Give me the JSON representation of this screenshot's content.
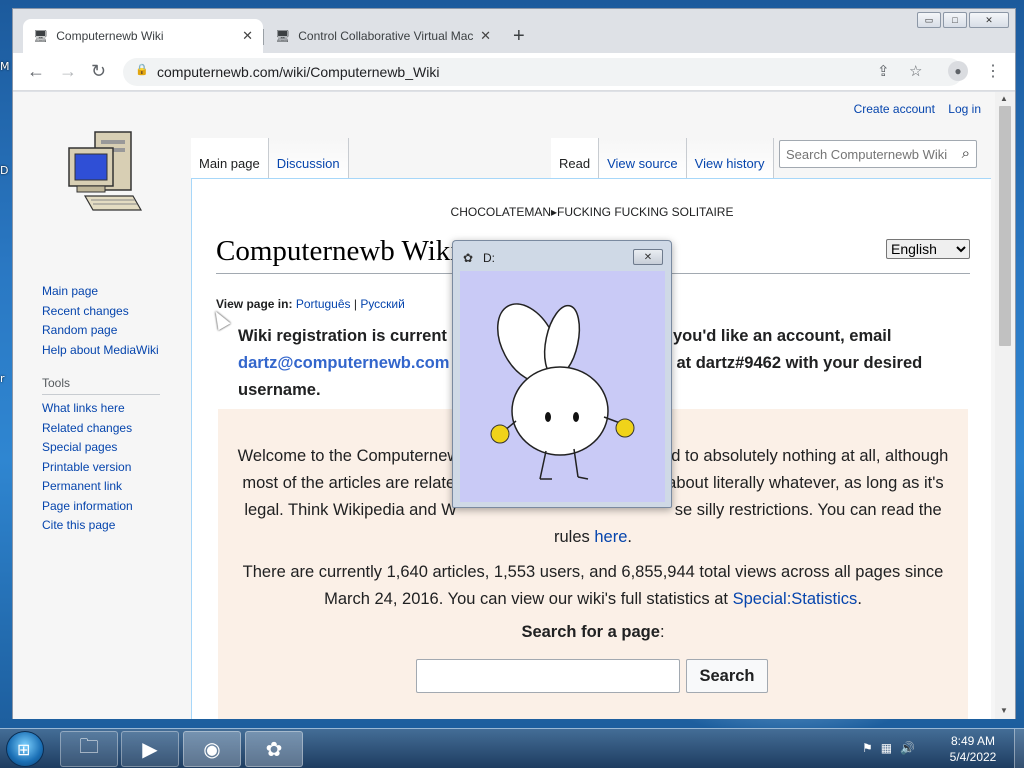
{
  "browser": {
    "tabs": [
      {
        "title": "Computernewb Wiki",
        "active": true
      },
      {
        "title": "Control Collaborative Virtual Mac",
        "active": false
      }
    ],
    "url": "computernewb.com/wiki/Computernewb_Wiki",
    "window_controls": {
      "minimize": "▭",
      "maximize": "□",
      "close": "✕"
    }
  },
  "wiki": {
    "personal": {
      "create_account": "Create account",
      "login": "Log in"
    },
    "namespaces": [
      "Main page",
      "Discussion"
    ],
    "views": [
      "Read",
      "View source",
      "View history"
    ],
    "search_placeholder": "Search Computernewb Wiki",
    "sitenotice": "CHOCOLATEMAN▸FUCKING FUCKING SOLITAIRE",
    "heading": "Computernewb Wiki",
    "language": "English",
    "view_page_in_label": "View page in:",
    "view_page_in": [
      "Português",
      "Русский"
    ],
    "registration": {
      "line1": "Wiki registration is current",
      "line1_tail": "f you'd like an account, email",
      "email": "dartz@computernewb.com",
      "line2_tail": "rd at dartz#9462 with your desired",
      "line3": "username."
    },
    "welcome": {
      "p1_l1_a": "Welcome to the Computernew",
      "p1_l1_b": "d to absolutely nothing at all, although",
      "p1_l2_a": "most of the articles are relate",
      "p1_l2_b": "about literally whatever, as long as it's",
      "p1_l3_a": "legal. Think Wikipedia and W",
      "p1_l3_b": "se silly restrictions. You can read the",
      "p1_l4_a": "rules ",
      "p1_l4_link": "here",
      "p1_l4_b": ".",
      "p2_a": "There are currently 1,640 articles, 1,553 users, and 6,855,944 total views across all pages since March 24, 2016. You can view our wiki's full statistics at ",
      "p2_link": "Special:Statistics",
      "p2_b": ".",
      "search_label_bold": "Search for a page",
      "search_label_tail": ":",
      "search_button": "Search"
    },
    "sidebar": {
      "nav": [
        "Main page",
        "Recent changes",
        "Random page",
        "Help about MediaWiki"
      ],
      "tools_heading": "Tools",
      "tools": [
        "What links here",
        "Related changes",
        "Special pages",
        "Printable version",
        "Permanent link",
        "Page information",
        "Cite this page"
      ]
    }
  },
  "popup": {
    "title": "D:",
    "close": "✕"
  },
  "taskbar": {
    "time": "8:49 AM",
    "date": "5/4/2022"
  },
  "desktop_fragments": [
    "M",
    "D",
    "r"
  ],
  "colors": {
    "link": "#0645ad",
    "email": "#3366cc",
    "welcome_bg": "#fbf0e7",
    "popup_bg": "#c9caf6"
  }
}
